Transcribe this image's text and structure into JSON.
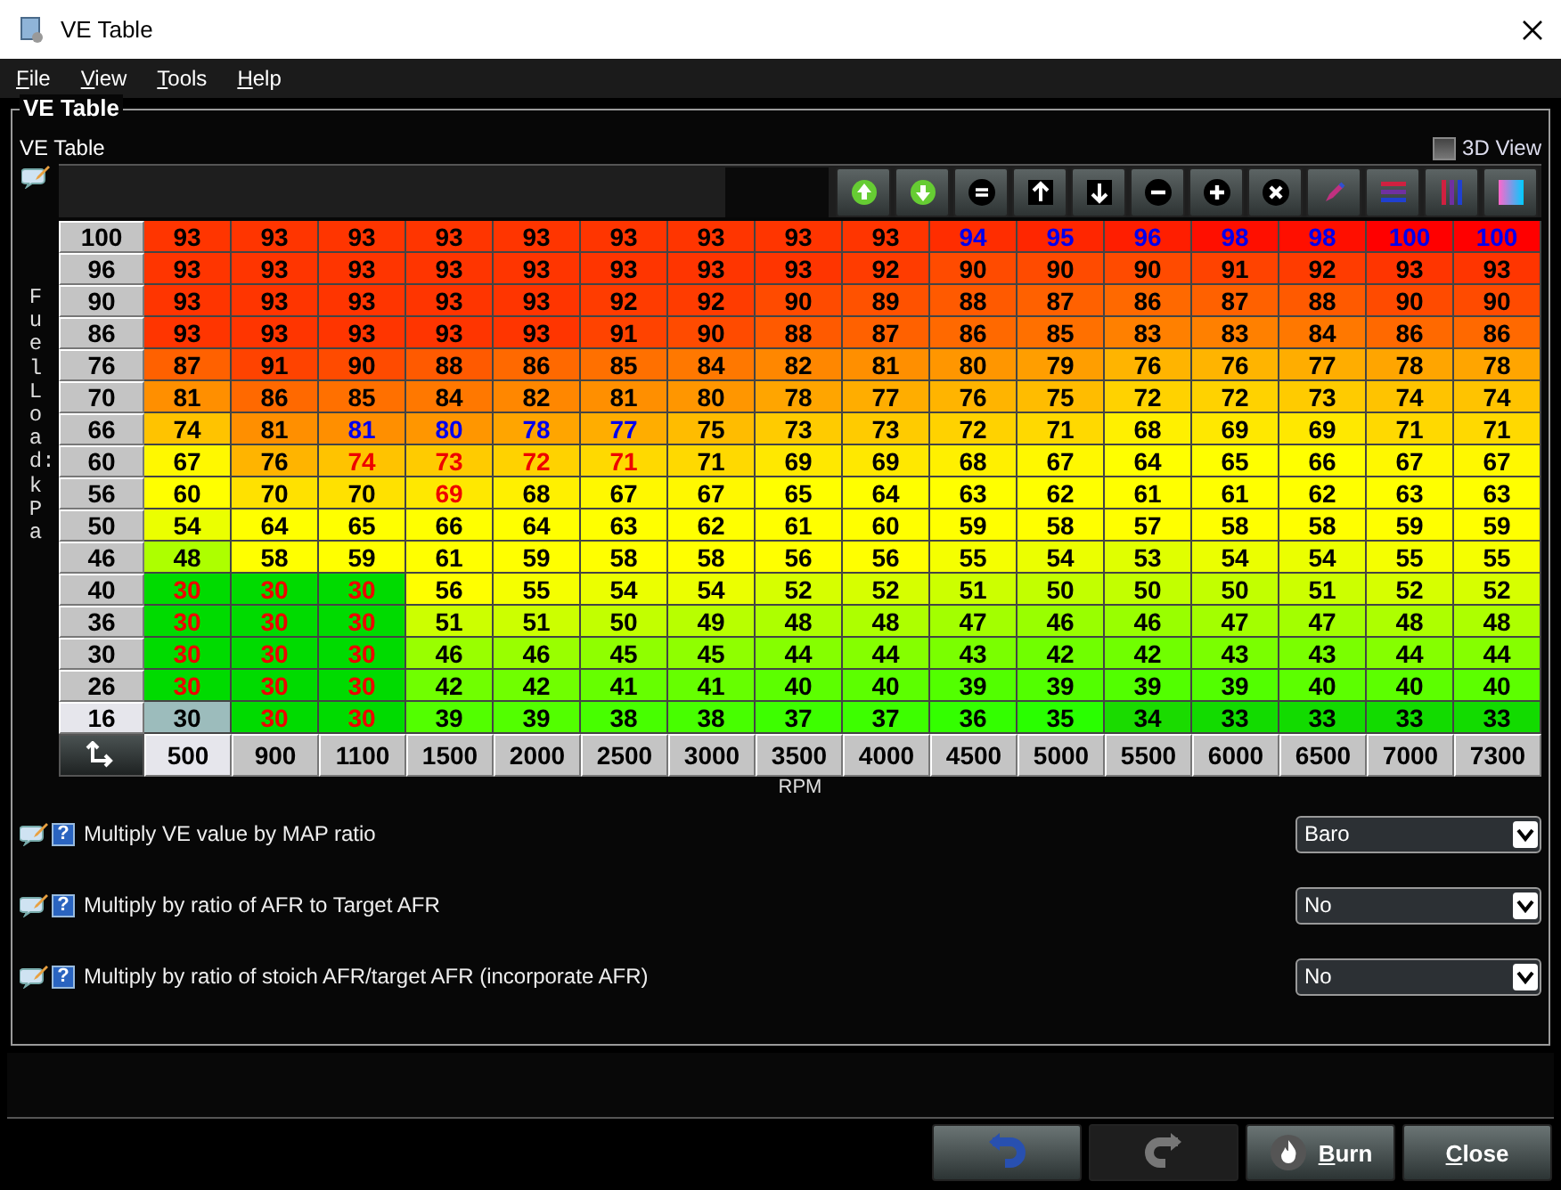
{
  "window": {
    "title": "VE Table"
  },
  "menu": [
    "File",
    "View",
    "Tools",
    "Help"
  ],
  "panel": {
    "title": "VE Table",
    "subtitle": "VE Table",
    "view_3d": {
      "label": "3D View",
      "checked": false
    }
  },
  "table": {
    "y_axis_label": "Fuel Load: kPa",
    "x_axis_label": "RPM",
    "rows": [
      {
        "label": "100",
        "selected": false,
        "cells": [
          {
            "value": "93",
            "kind": "plain"
          },
          {
            "value": "93",
            "kind": "plain"
          },
          {
            "value": "93",
            "kind": "plain"
          },
          {
            "value": "93",
            "kind": "plain"
          },
          {
            "value": "93",
            "kind": "plain"
          },
          {
            "value": "93",
            "kind": "plain"
          },
          {
            "value": "93",
            "kind": "plain"
          },
          {
            "value": "93",
            "kind": "plain"
          },
          {
            "value": "93",
            "kind": "plain"
          },
          {
            "value": "94",
            "kind": "blue"
          },
          {
            "value": "95",
            "kind": "blue"
          },
          {
            "value": "96",
            "kind": "blue"
          },
          {
            "value": "98",
            "kind": "blue"
          },
          {
            "value": "98",
            "kind": "blue"
          },
          {
            "value": "100",
            "kind": "blue"
          },
          {
            "value": "100",
            "kind": "blue"
          }
        ]
      },
      {
        "label": "96",
        "selected": false,
        "cells": [
          {
            "value": "93",
            "kind": "plain"
          },
          {
            "value": "93",
            "kind": "plain"
          },
          {
            "value": "93",
            "kind": "plain"
          },
          {
            "value": "93",
            "kind": "plain"
          },
          {
            "value": "93",
            "kind": "plain"
          },
          {
            "value": "93",
            "kind": "plain"
          },
          {
            "value": "93",
            "kind": "plain"
          },
          {
            "value": "93",
            "kind": "plain"
          },
          {
            "value": "92",
            "kind": "plain"
          },
          {
            "value": "90",
            "kind": "plain"
          },
          {
            "value": "90",
            "kind": "plain"
          },
          {
            "value": "90",
            "kind": "plain"
          },
          {
            "value": "91",
            "kind": "plain"
          },
          {
            "value": "92",
            "kind": "plain"
          },
          {
            "value": "93",
            "kind": "plain"
          },
          {
            "value": "93",
            "kind": "plain"
          }
        ]
      },
      {
        "label": "90",
        "selected": false,
        "cells": [
          {
            "value": "93",
            "kind": "plain"
          },
          {
            "value": "93",
            "kind": "plain"
          },
          {
            "value": "93",
            "kind": "plain"
          },
          {
            "value": "93",
            "kind": "plain"
          },
          {
            "value": "93",
            "kind": "plain"
          },
          {
            "value": "92",
            "kind": "plain"
          },
          {
            "value": "92",
            "kind": "plain"
          },
          {
            "value": "90",
            "kind": "plain"
          },
          {
            "value": "89",
            "kind": "plain"
          },
          {
            "value": "88",
            "kind": "plain"
          },
          {
            "value": "87",
            "kind": "plain"
          },
          {
            "value": "86",
            "kind": "plain"
          },
          {
            "value": "87",
            "kind": "plain"
          },
          {
            "value": "88",
            "kind": "plain"
          },
          {
            "value": "90",
            "kind": "plain"
          },
          {
            "value": "90",
            "kind": "plain"
          }
        ]
      },
      {
        "label": "86",
        "selected": false,
        "cells": [
          {
            "value": "93",
            "kind": "plain"
          },
          {
            "value": "93",
            "kind": "plain"
          },
          {
            "value": "93",
            "kind": "plain"
          },
          {
            "value": "93",
            "kind": "plain"
          },
          {
            "value": "93",
            "kind": "plain"
          },
          {
            "value": "91",
            "kind": "plain"
          },
          {
            "value": "90",
            "kind": "plain"
          },
          {
            "value": "88",
            "kind": "plain"
          },
          {
            "value": "87",
            "kind": "plain"
          },
          {
            "value": "86",
            "kind": "plain"
          },
          {
            "value": "85",
            "kind": "plain"
          },
          {
            "value": "83",
            "kind": "plain"
          },
          {
            "value": "83",
            "kind": "plain"
          },
          {
            "value": "84",
            "kind": "plain"
          },
          {
            "value": "86",
            "kind": "plain"
          },
          {
            "value": "86",
            "kind": "plain"
          }
        ]
      },
      {
        "label": "76",
        "selected": false,
        "cells": [
          {
            "value": "87",
            "kind": "plain"
          },
          {
            "value": "91",
            "kind": "plain"
          },
          {
            "value": "90",
            "kind": "plain"
          },
          {
            "value": "88",
            "kind": "plain"
          },
          {
            "value": "86",
            "kind": "plain"
          },
          {
            "value": "85",
            "kind": "plain"
          },
          {
            "value": "84",
            "kind": "plain"
          },
          {
            "value": "82",
            "kind": "plain"
          },
          {
            "value": "81",
            "kind": "plain"
          },
          {
            "value": "80",
            "kind": "plain"
          },
          {
            "value": "79",
            "kind": "plain"
          },
          {
            "value": "76",
            "kind": "plain"
          },
          {
            "value": "76",
            "kind": "plain"
          },
          {
            "value": "77",
            "kind": "plain"
          },
          {
            "value": "78",
            "kind": "plain"
          },
          {
            "value": "78",
            "kind": "plain"
          }
        ]
      },
      {
        "label": "70",
        "selected": false,
        "cells": [
          {
            "value": "81",
            "kind": "plain"
          },
          {
            "value": "86",
            "kind": "plain"
          },
          {
            "value": "85",
            "kind": "plain"
          },
          {
            "value": "84",
            "kind": "plain"
          },
          {
            "value": "82",
            "kind": "plain"
          },
          {
            "value": "81",
            "kind": "plain"
          },
          {
            "value": "80",
            "kind": "plain"
          },
          {
            "value": "78",
            "kind": "plain"
          },
          {
            "value": "77",
            "kind": "plain"
          },
          {
            "value": "76",
            "kind": "plain"
          },
          {
            "value": "75",
            "kind": "plain"
          },
          {
            "value": "72",
            "kind": "plain"
          },
          {
            "value": "72",
            "kind": "plain"
          },
          {
            "value": "73",
            "kind": "plain"
          },
          {
            "value": "74",
            "kind": "plain"
          },
          {
            "value": "74",
            "kind": "plain"
          }
        ]
      },
      {
        "label": "66",
        "selected": false,
        "cells": [
          {
            "value": "74",
            "kind": "plain"
          },
          {
            "value": "81",
            "kind": "plain"
          },
          {
            "value": "81",
            "kind": "blue"
          },
          {
            "value": "80",
            "kind": "blue"
          },
          {
            "value": "78",
            "kind": "blue"
          },
          {
            "value": "77",
            "kind": "blue"
          },
          {
            "value": "75",
            "kind": "plain"
          },
          {
            "value": "73",
            "kind": "plain"
          },
          {
            "value": "73",
            "kind": "plain"
          },
          {
            "value": "72",
            "kind": "plain"
          },
          {
            "value": "71",
            "kind": "plain"
          },
          {
            "value": "68",
            "kind": "plain"
          },
          {
            "value": "69",
            "kind": "plain"
          },
          {
            "value": "69",
            "kind": "plain"
          },
          {
            "value": "71",
            "kind": "plain"
          },
          {
            "value": "71",
            "kind": "plain"
          }
        ]
      },
      {
        "label": "60",
        "selected": false,
        "cells": [
          {
            "value": "67",
            "kind": "plain"
          },
          {
            "value": "76",
            "kind": "plain"
          },
          {
            "value": "74",
            "kind": "red"
          },
          {
            "value": "73",
            "kind": "red"
          },
          {
            "value": "72",
            "kind": "red"
          },
          {
            "value": "71",
            "kind": "red"
          },
          {
            "value": "71",
            "kind": "plain"
          },
          {
            "value": "69",
            "kind": "plain"
          },
          {
            "value": "69",
            "kind": "plain"
          },
          {
            "value": "68",
            "kind": "plain"
          },
          {
            "value": "67",
            "kind": "plain"
          },
          {
            "value": "64",
            "kind": "plain"
          },
          {
            "value": "65",
            "kind": "plain"
          },
          {
            "value": "66",
            "kind": "plain"
          },
          {
            "value": "67",
            "kind": "plain"
          },
          {
            "value": "67",
            "kind": "plain"
          }
        ]
      },
      {
        "label": "56",
        "selected": false,
        "cells": [
          {
            "value": "60",
            "kind": "plain"
          },
          {
            "value": "70",
            "kind": "plain"
          },
          {
            "value": "70",
            "kind": "plain"
          },
          {
            "value": "69",
            "kind": "red"
          },
          {
            "value": "68",
            "kind": "plain"
          },
          {
            "value": "67",
            "kind": "plain"
          },
          {
            "value": "67",
            "kind": "plain"
          },
          {
            "value": "65",
            "kind": "plain"
          },
          {
            "value": "64",
            "kind": "plain"
          },
          {
            "value": "63",
            "kind": "plain"
          },
          {
            "value": "62",
            "kind": "plain"
          },
          {
            "value": "61",
            "kind": "plain"
          },
          {
            "value": "61",
            "kind": "plain"
          },
          {
            "value": "62",
            "kind": "plain"
          },
          {
            "value": "63",
            "kind": "plain"
          },
          {
            "value": "63",
            "kind": "plain"
          }
        ]
      },
      {
        "label": "50",
        "selected": false,
        "cells": [
          {
            "value": "54",
            "kind": "plain"
          },
          {
            "value": "64",
            "kind": "plain"
          },
          {
            "value": "65",
            "kind": "plain"
          },
          {
            "value": "66",
            "kind": "plain"
          },
          {
            "value": "64",
            "kind": "plain"
          },
          {
            "value": "63",
            "kind": "plain"
          },
          {
            "value": "62",
            "kind": "plain"
          },
          {
            "value": "61",
            "kind": "plain"
          },
          {
            "value": "60",
            "kind": "plain"
          },
          {
            "value": "59",
            "kind": "plain"
          },
          {
            "value": "58",
            "kind": "plain"
          },
          {
            "value": "57",
            "kind": "plain"
          },
          {
            "value": "58",
            "kind": "plain"
          },
          {
            "value": "58",
            "kind": "plain"
          },
          {
            "value": "59",
            "kind": "plain"
          },
          {
            "value": "59",
            "kind": "plain"
          }
        ]
      },
      {
        "label": "46",
        "selected": false,
        "cells": [
          {
            "value": "48",
            "kind": "plain"
          },
          {
            "value": "58",
            "kind": "plain"
          },
          {
            "value": "59",
            "kind": "plain"
          },
          {
            "value": "61",
            "kind": "plain"
          },
          {
            "value": "59",
            "kind": "plain"
          },
          {
            "value": "58",
            "kind": "plain"
          },
          {
            "value": "58",
            "kind": "plain"
          },
          {
            "value": "56",
            "kind": "plain"
          },
          {
            "value": "56",
            "kind": "plain"
          },
          {
            "value": "55",
            "kind": "plain"
          },
          {
            "value": "54",
            "kind": "plain"
          },
          {
            "value": "53",
            "kind": "plain"
          },
          {
            "value": "54",
            "kind": "plain"
          },
          {
            "value": "54",
            "kind": "plain"
          },
          {
            "value": "55",
            "kind": "plain"
          },
          {
            "value": "55",
            "kind": "plain"
          }
        ]
      },
      {
        "label": "40",
        "selected": false,
        "cells": [
          {
            "value": "30",
            "kind": "red"
          },
          {
            "value": "30",
            "kind": "red"
          },
          {
            "value": "30",
            "kind": "red"
          },
          {
            "value": "56",
            "kind": "plain"
          },
          {
            "value": "55",
            "kind": "plain"
          },
          {
            "value": "54",
            "kind": "plain"
          },
          {
            "value": "54",
            "kind": "plain"
          },
          {
            "value": "52",
            "kind": "plain"
          },
          {
            "value": "52",
            "kind": "plain"
          },
          {
            "value": "51",
            "kind": "plain"
          },
          {
            "value": "50",
            "kind": "plain"
          },
          {
            "value": "50",
            "kind": "plain"
          },
          {
            "value": "50",
            "kind": "plain"
          },
          {
            "value": "51",
            "kind": "plain"
          },
          {
            "value": "52",
            "kind": "plain"
          },
          {
            "value": "52",
            "kind": "plain"
          }
        ]
      },
      {
        "label": "36",
        "selected": false,
        "cells": [
          {
            "value": "30",
            "kind": "red"
          },
          {
            "value": "30",
            "kind": "red"
          },
          {
            "value": "30",
            "kind": "red"
          },
          {
            "value": "51",
            "kind": "plain"
          },
          {
            "value": "51",
            "kind": "plain"
          },
          {
            "value": "50",
            "kind": "plain"
          },
          {
            "value": "49",
            "kind": "plain"
          },
          {
            "value": "48",
            "kind": "plain"
          },
          {
            "value": "48",
            "kind": "plain"
          },
          {
            "value": "47",
            "kind": "plain"
          },
          {
            "value": "46",
            "kind": "plain"
          },
          {
            "value": "46",
            "kind": "plain"
          },
          {
            "value": "47",
            "kind": "plain"
          },
          {
            "value": "47",
            "kind": "plain"
          },
          {
            "value": "48",
            "kind": "plain"
          },
          {
            "value": "48",
            "kind": "plain"
          }
        ]
      },
      {
        "label": "30",
        "selected": false,
        "cells": [
          {
            "value": "30",
            "kind": "red"
          },
          {
            "value": "30",
            "kind": "red"
          },
          {
            "value": "30",
            "kind": "red"
          },
          {
            "value": "46",
            "kind": "plain"
          },
          {
            "value": "46",
            "kind": "plain"
          },
          {
            "value": "45",
            "kind": "plain"
          },
          {
            "value": "45",
            "kind": "plain"
          },
          {
            "value": "44",
            "kind": "plain"
          },
          {
            "value": "44",
            "kind": "plain"
          },
          {
            "value": "43",
            "kind": "plain"
          },
          {
            "value": "42",
            "kind": "plain"
          },
          {
            "value": "42",
            "kind": "plain"
          },
          {
            "value": "43",
            "kind": "plain"
          },
          {
            "value": "43",
            "kind": "plain"
          },
          {
            "value": "44",
            "kind": "plain"
          },
          {
            "value": "44",
            "kind": "plain"
          }
        ]
      },
      {
        "label": "26",
        "selected": false,
        "cells": [
          {
            "value": "30",
            "kind": "red"
          },
          {
            "value": "30",
            "kind": "red"
          },
          {
            "value": "30",
            "kind": "red"
          },
          {
            "value": "42",
            "kind": "plain"
          },
          {
            "value": "42",
            "kind": "plain"
          },
          {
            "value": "41",
            "kind": "plain"
          },
          {
            "value": "41",
            "kind": "plain"
          },
          {
            "value": "40",
            "kind": "plain"
          },
          {
            "value": "40",
            "kind": "plain"
          },
          {
            "value": "39",
            "kind": "plain"
          },
          {
            "value": "39",
            "kind": "plain"
          },
          {
            "value": "39",
            "kind": "plain"
          },
          {
            "value": "39",
            "kind": "plain"
          },
          {
            "value": "40",
            "kind": "plain"
          },
          {
            "value": "40",
            "kind": "plain"
          },
          {
            "value": "40",
            "kind": "plain"
          }
        ]
      },
      {
        "label": "16",
        "selected": true,
        "cells": [
          {
            "value": "30",
            "kind": "plain"
          },
          {
            "value": "30",
            "kind": "red"
          },
          {
            "value": "30",
            "kind": "red"
          },
          {
            "value": "39",
            "kind": "plain"
          },
          {
            "value": "39",
            "kind": "plain"
          },
          {
            "value": "38",
            "kind": "plain"
          },
          {
            "value": "38",
            "kind": "plain"
          },
          {
            "value": "37",
            "kind": "plain"
          },
          {
            "value": "37",
            "kind": "plain"
          },
          {
            "value": "36",
            "kind": "plain"
          },
          {
            "value": "35",
            "kind": "plain"
          },
          {
            "value": "34",
            "kind": "plain"
          },
          {
            "value": "33",
            "kind": "plain"
          },
          {
            "value": "33",
            "kind": "plain"
          },
          {
            "value": "33",
            "kind": "plain"
          },
          {
            "value": "33",
            "kind": "plain"
          }
        ]
      }
    ],
    "x_bins": [
      {
        "label": "500",
        "selected": true
      },
      {
        "label": "900",
        "selected": false
      },
      {
        "label": "1100",
        "selected": false
      },
      {
        "label": "1500",
        "selected": false
      },
      {
        "label": "2000",
        "selected": false
      },
      {
        "label": "2500",
        "selected": false
      },
      {
        "label": "3000",
        "selected": false
      },
      {
        "label": "3500",
        "selected": false
      },
      {
        "label": "4000",
        "selected": false
      },
      {
        "label": "4500",
        "selected": false
      },
      {
        "label": "5000",
        "selected": false
      },
      {
        "label": "5500",
        "selected": false
      },
      {
        "label": "6000",
        "selected": false
      },
      {
        "label": "6500",
        "selected": false
      },
      {
        "label": "7000",
        "selected": false
      },
      {
        "label": "7300",
        "selected": false
      }
    ]
  },
  "settings": [
    {
      "label": "Multiply VE value by MAP ratio",
      "help": "?",
      "value": "Baro"
    },
    {
      "label": "Multiply by ratio of AFR to Target AFR",
      "help": "?",
      "value": "No"
    },
    {
      "label": "Multiply by ratio of stoich AFR/target AFR (incorporate AFR)",
      "help": "?",
      "value": "No"
    }
  ],
  "buttons": [
    {
      "kind": "undo",
      "disabled": false
    },
    {
      "kind": "redo",
      "disabled": true
    },
    {
      "kind": "burn",
      "label": "Burn",
      "disabled": false
    },
    {
      "kind": "close",
      "label": "Close",
      "disabled": false
    }
  ]
}
